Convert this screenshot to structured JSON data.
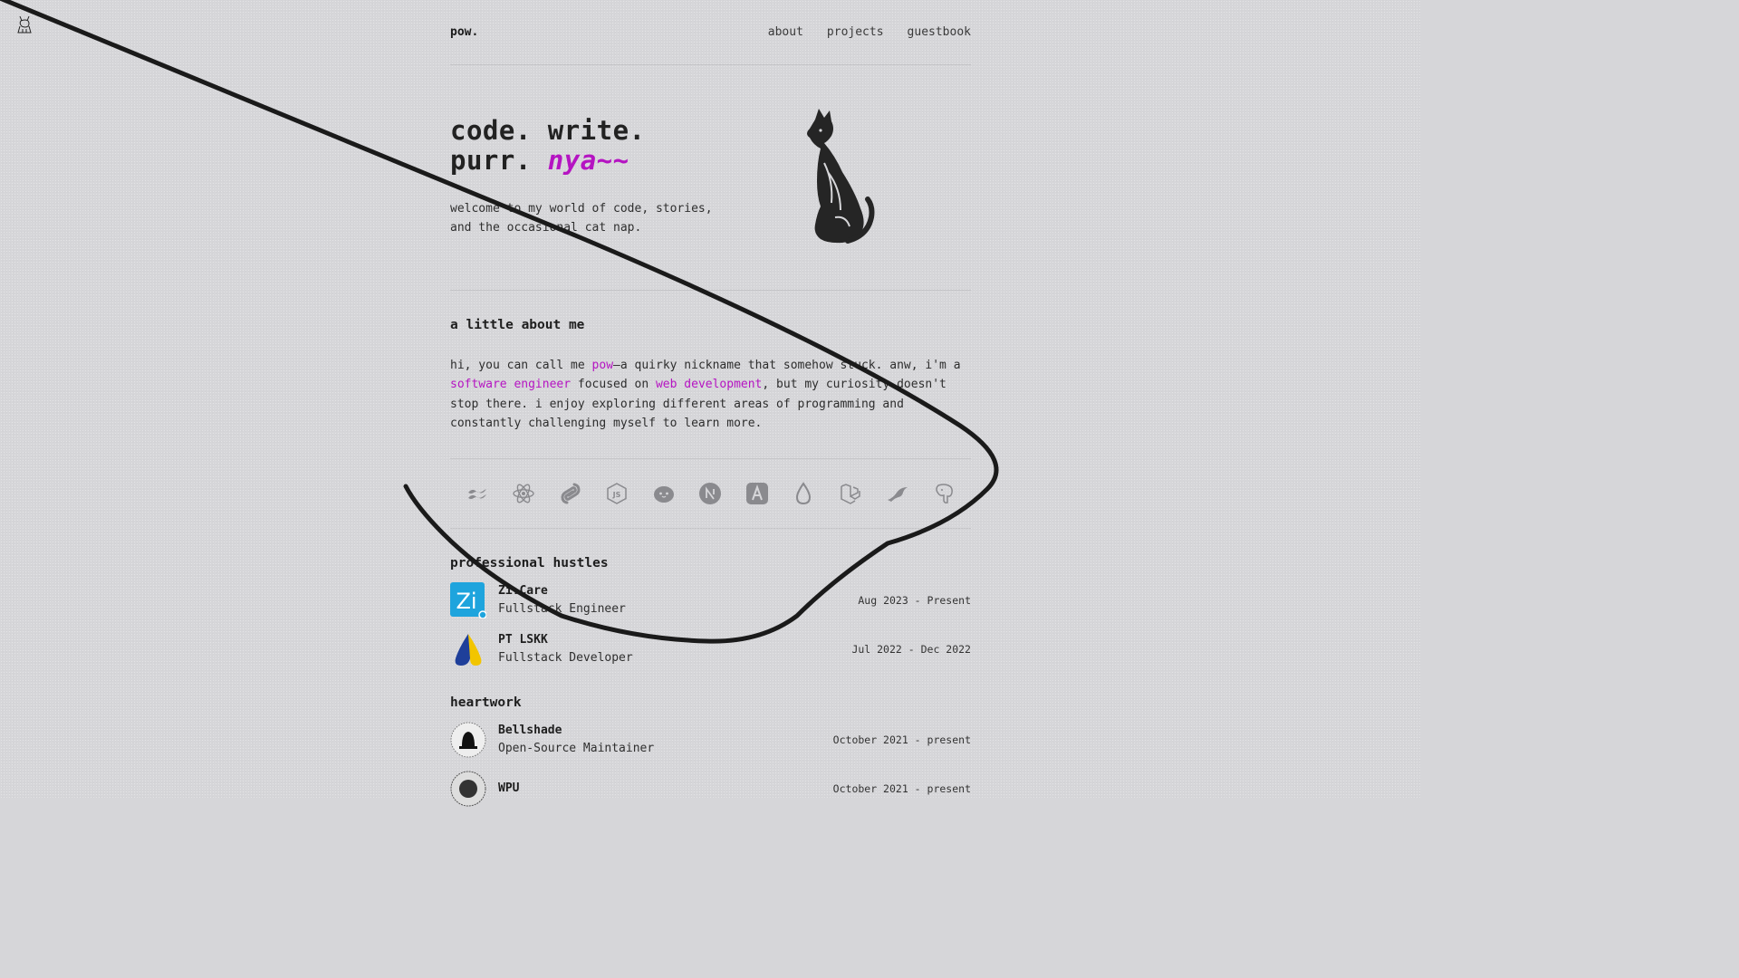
{
  "nav": {
    "brand": "pow.",
    "links": [
      "about",
      "projects",
      "guestbook"
    ]
  },
  "hero": {
    "line1": "code. write.",
    "line2_prefix": "purr.",
    "line2_highlight": "nya~~",
    "subtitle": "welcome to my world of code, stories, and the occasional cat nap."
  },
  "about": {
    "heading": "a little about me",
    "p_1": "hi, you can call me ",
    "hl_1": "pow",
    "p_2": "—a quirky nickname that somehow stuck. anw, i'm a ",
    "hl_2": "software engineer",
    "p_3": " focused on ",
    "hl_3": "web development",
    "p_4": ", but my curiosity doesn't stop there. i enjoy exploring different areas of programming and constantly challenging myself to learn more."
  },
  "tech_icons": [
    "tailwind-icon",
    "react-icon",
    "svelte-icon",
    "nodejs-icon",
    "bun-icon",
    "nextjs-icon",
    "astro-icon",
    "drizzle-icon",
    "laravel-icon",
    "mariadb-icon",
    "postgresql-icon"
  ],
  "professional": {
    "heading": "professional hustles",
    "items": [
      {
        "name": "Zi.Care",
        "role": "Fullstack Engineer",
        "date": "Aug 2023 - Present"
      },
      {
        "name": "PT LSKK",
        "role": "Fullstack Developer",
        "date": "Jul 2022 - Dec 2022"
      }
    ]
  },
  "heartwork": {
    "heading": "heartwork",
    "items": [
      {
        "name": "Bellshade",
        "role": "Open-Source Maintainer",
        "date": "October 2021 - present"
      },
      {
        "name": "WPU",
        "role": "",
        "date": "October 2021 - present"
      }
    ]
  },
  "colors": {
    "accent": "#b514c2",
    "background": "#d6d6d9",
    "text": "#1e1e1e"
  }
}
